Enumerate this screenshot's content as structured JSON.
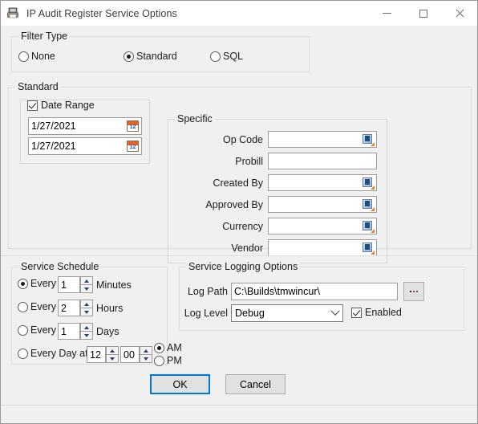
{
  "window": {
    "title": "IP Audit Register Service Options",
    "icon": "printer-device-icon",
    "minimize_label": "Minimize",
    "maximize_label": "Maximize",
    "close_label": "Close"
  },
  "filter_type": {
    "group_title": "Filter Type",
    "selected": "Standard",
    "options": [
      {
        "label": "None",
        "checked": false
      },
      {
        "label": "Standard",
        "checked": true
      },
      {
        "label": "SQL",
        "checked": false
      }
    ]
  },
  "standard": {
    "group_title": "Standard",
    "date_range": {
      "checkbox_label": "Date Range",
      "checked": true,
      "from_value": "1/27/2021",
      "to_value": "1/27/2021",
      "icon": "calendar-icon"
    },
    "specific": {
      "group_title": "Specific",
      "fields": [
        {
          "label": "Op Code",
          "value": "",
          "lookup": true
        },
        {
          "label": "Probill",
          "value": "",
          "lookup": false
        },
        {
          "label": "Created By",
          "value": "",
          "lookup": true
        },
        {
          "label": "Approved By",
          "value": "",
          "lookup": true
        },
        {
          "label": "Currency",
          "value": "",
          "lookup": true
        },
        {
          "label": "Vendor",
          "value": "",
          "lookup": true
        }
      ]
    }
  },
  "service_schedule": {
    "group_title": "Service Schedule",
    "selected": "Every Minutes",
    "rows": [
      {
        "prefix": "Every",
        "value": "1",
        "unit": "Minutes",
        "checked": true
      },
      {
        "prefix": "Every",
        "value": "2",
        "unit": "Hours",
        "checked": false
      },
      {
        "prefix": "Every",
        "value": "1",
        "unit": "Days",
        "checked": false
      }
    ],
    "every_day_at": {
      "prefix": "Every Day at",
      "checked": false,
      "hour": "12",
      "minute": "00",
      "meridiem_options": [
        {
          "label": "AM",
          "checked": true
        },
        {
          "label": "PM",
          "checked": false
        }
      ]
    }
  },
  "service_logging": {
    "group_title": "Service Logging Options",
    "log_path_label": "Log Path",
    "log_path_value": "C:\\Builds\\tmwincur\\",
    "browse_label": "...",
    "log_level_label": "Log Level",
    "log_level_value": "Debug",
    "enabled_label": "Enabled",
    "enabled_checked": true
  },
  "footer": {
    "ok_label": "OK",
    "cancel_label": "Cancel"
  },
  "colors": {
    "accent": "#0078d7",
    "window_bg": "#f0f0f0",
    "titlebar_bg": "#ffffff",
    "field_bg": "#ffffff",
    "group_border": "#dcdcdc"
  }
}
